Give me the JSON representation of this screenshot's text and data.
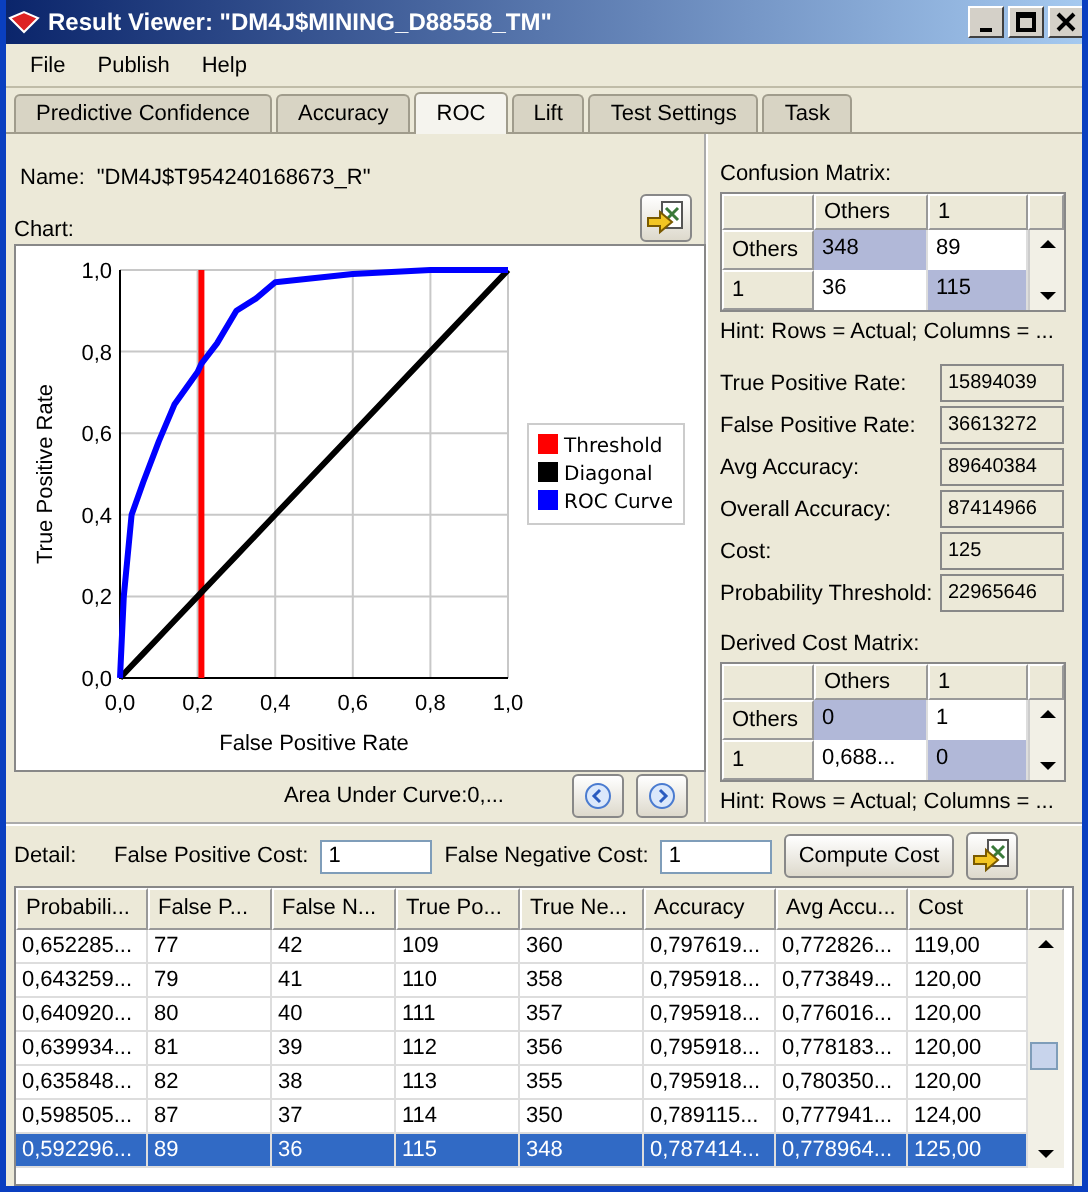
{
  "window": {
    "title": "Result Viewer: \"DM4J$MINING_D88558_TM\""
  },
  "menu": [
    "File",
    "Publish",
    "Help"
  ],
  "tabs": [
    {
      "label": "Predictive Confidence",
      "selected": false
    },
    {
      "label": "Accuracy",
      "selected": false
    },
    {
      "label": "ROC",
      "selected": true
    },
    {
      "label": "Lift",
      "selected": false
    },
    {
      "label": "Test Settings",
      "selected": false
    },
    {
      "label": "Task",
      "selected": false
    }
  ],
  "name_label": "Name:",
  "name_value": "\"DM4J$T954240168673_R\"",
  "chart_label": "Chart:",
  "chart": {
    "chart_data": {
      "type": "line",
      "xlabel": "False Positive Rate",
      "ylabel": "True Positive Rate",
      "x": [
        0,
        0.01,
        0.03,
        0.06,
        0.1,
        0.14,
        0.2,
        0.21,
        0.21,
        0.25,
        0.3,
        0.35,
        0.4,
        0.6,
        0.8,
        1.0
      ],
      "series": [
        {
          "name": "Threshold",
          "color": "#ff0000",
          "values": [
            null,
            null,
            null,
            null,
            null,
            null,
            null,
            0,
            1,
            null,
            null,
            null,
            null,
            null,
            null,
            null
          ]
        },
        {
          "name": "Diagonal",
          "color": "#000000",
          "values": [
            0,
            0.01,
            0.03,
            0.06,
            0.1,
            0.14,
            0.2,
            0.21,
            0.21,
            0.25,
            0.3,
            0.35,
            0.4,
            0.6,
            0.8,
            1.0
          ]
        },
        {
          "name": "ROC Curve",
          "color": "#0000ff",
          "values": [
            0,
            0.2,
            0.4,
            0.48,
            0.58,
            0.67,
            0.75,
            0.77,
            0.77,
            0.82,
            0.9,
            0.93,
            0.97,
            0.99,
            1.0,
            1.0
          ]
        }
      ],
      "xlim": [
        0,
        1
      ],
      "ylim": [
        0,
        1
      ],
      "xticks": [
        {
          "value": 0,
          "label": "0,0"
        },
        {
          "value": 0.2,
          "label": "0,2"
        },
        {
          "value": 0.4,
          "label": "0,4"
        },
        {
          "value": 0.6,
          "label": "0,6"
        },
        {
          "value": 0.8,
          "label": "0,8"
        },
        {
          "value": 1,
          "label": "1,0"
        }
      ],
      "yticks": [
        {
          "value": 0,
          "label": "0,0"
        },
        {
          "value": 0.2,
          "label": "0,2"
        },
        {
          "value": 0.4,
          "label": "0,4"
        },
        {
          "value": 0.6,
          "label": "0,6"
        },
        {
          "value": 0.8,
          "label": "0,8"
        },
        {
          "value": 1,
          "label": "1,0"
        }
      ],
      "grid": true,
      "legend": "right"
    }
  },
  "auc": "Area Under Curve:0,...",
  "confusion": {
    "label": "Confusion Matrix:",
    "columns": [
      "Others",
      "1"
    ],
    "rows": [
      {
        "header": "Others",
        "cells": [
          {
            "text": "348",
            "highlighted": true
          },
          {
            "text": "89",
            "highlighted": false
          }
        ]
      },
      {
        "header": "1",
        "cells": [
          {
            "text": "36",
            "highlighted": false
          },
          {
            "text": "115",
            "highlighted": true
          }
        ]
      }
    ],
    "hint": "Hint: Rows = Actual; Columns = ..."
  },
  "metrics": [
    {
      "label": "True Positive Rate:",
      "value": "15894039"
    },
    {
      "label": "False Positive Rate:",
      "value": "36613272"
    },
    {
      "label": "Avg Accuracy:",
      "value": "89640384"
    },
    {
      "label": "Overall Accuracy:",
      "value": "87414966"
    },
    {
      "label": "Cost:",
      "value": "125"
    },
    {
      "label": "Probability Threshold:",
      "value": "22965646"
    }
  ],
  "derived": {
    "label": "Derived Cost Matrix:",
    "columns": [
      "Others",
      "1"
    ],
    "rows": [
      {
        "header": "Others",
        "cells": [
          {
            "text": "0",
            "highlighted": true
          },
          {
            "text": "1",
            "highlighted": false
          }
        ]
      },
      {
        "header": "1",
        "cells": [
          {
            "text": "0,688...",
            "highlighted": false
          },
          {
            "text": "0",
            "highlighted": true
          }
        ]
      }
    ],
    "hint": "Hint: Rows = Actual; Columns = ..."
  },
  "detail": {
    "label": "Detail:",
    "fp_label": "False Positive Cost:",
    "fp_value": "1",
    "fn_label": "False Negative Cost:",
    "fn_value": "1",
    "button": "Compute Cost"
  },
  "table": {
    "columns": [
      "Probabili...",
      "False P...",
      "False N...",
      "True Po...",
      "True Ne...",
      "Accuracy",
      "Avg Accu...",
      "Cost"
    ],
    "rows": [
      {
        "selected": false,
        "cells": [
          "0,652285...",
          "77",
          "42",
          "109",
          "360",
          "0,797619...",
          "0,772826...",
          "119,00"
        ]
      },
      {
        "selected": false,
        "cells": [
          "0,643259...",
          "79",
          "41",
          "110",
          "358",
          "0,795918...",
          "0,773849...",
          "120,00"
        ]
      },
      {
        "selected": false,
        "cells": [
          "0,640920...",
          "80",
          "40",
          "111",
          "357",
          "0,795918...",
          "0,776016...",
          "120,00"
        ]
      },
      {
        "selected": false,
        "cells": [
          "0,639934...",
          "81",
          "39",
          "112",
          "356",
          "0,795918...",
          "0,778183...",
          "120,00"
        ]
      },
      {
        "selected": false,
        "cells": [
          "0,635848...",
          "82",
          "38",
          "113",
          "355",
          "0,795918...",
          "0,780350...",
          "120,00"
        ]
      },
      {
        "selected": false,
        "cells": [
          "0,598505...",
          "87",
          "37",
          "114",
          "350",
          "0,789115...",
          "0,777941...",
          "124,00"
        ]
      },
      {
        "selected": true,
        "cells": [
          "0,592296...",
          "89",
          "36",
          "115",
          "348",
          "0,787414...",
          "0,778964...",
          "125,00"
        ]
      }
    ]
  }
}
